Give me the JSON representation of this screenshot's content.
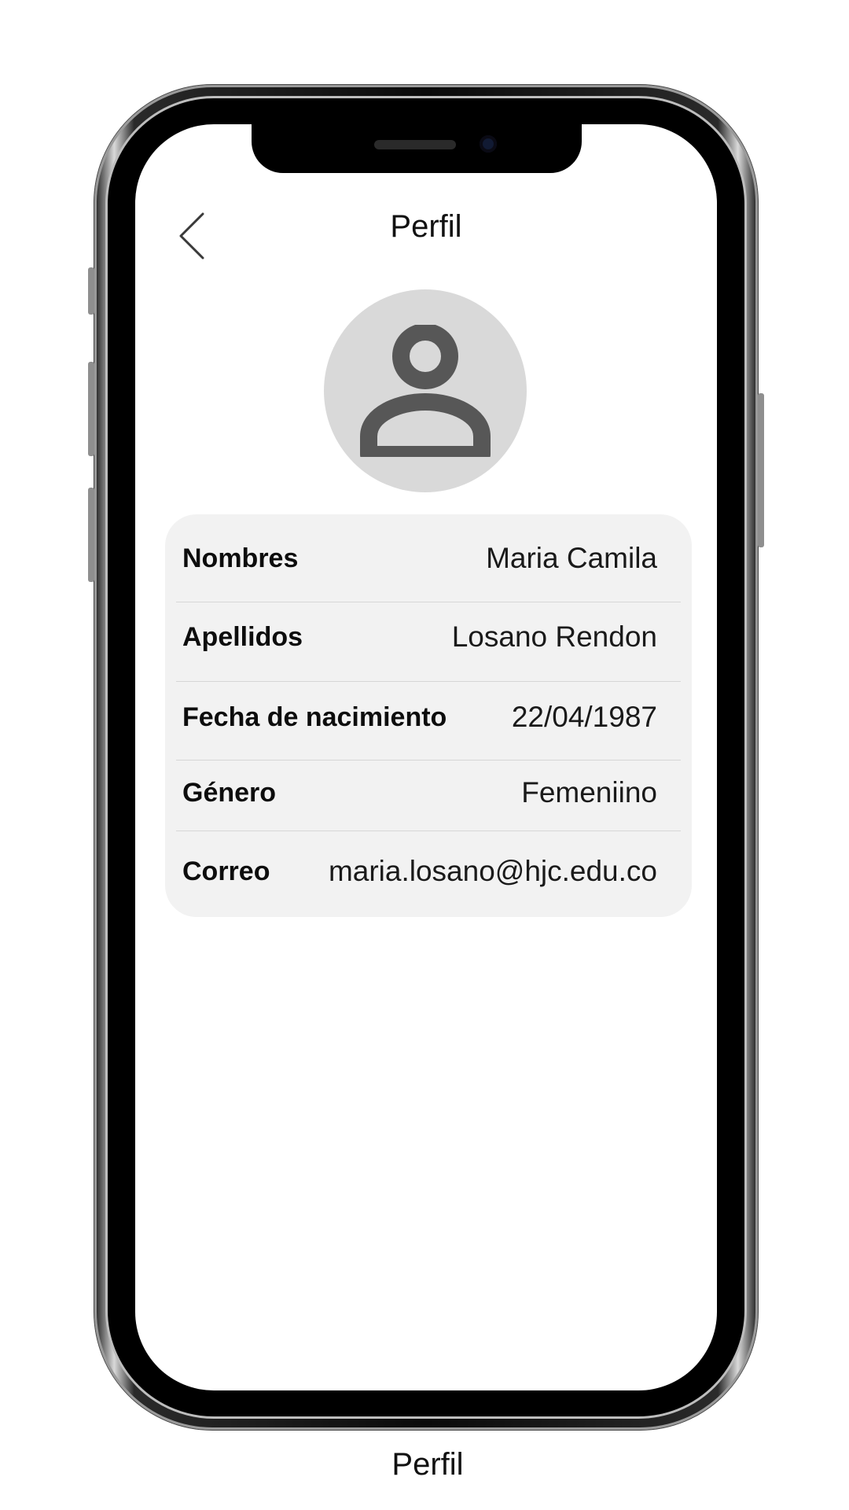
{
  "header": {
    "title": "Perfil",
    "back_icon": "chevron-left-icon"
  },
  "avatar": {
    "icon": "user-icon",
    "background": "#d9d9d9",
    "icon_color": "#575757"
  },
  "profile": {
    "rows": [
      {
        "label": "Nombres",
        "value": "Maria Camila"
      },
      {
        "label": "Apellidos",
        "value": "Losano Rendon"
      },
      {
        "label": "Fecha de nacimiento",
        "value": "22/04/1987"
      },
      {
        "label": "Género",
        "value": "Femeniino"
      },
      {
        "label": "Correo",
        "value": "maria.losano@hjc.edu.co"
      }
    ]
  },
  "caption": "Perfil"
}
